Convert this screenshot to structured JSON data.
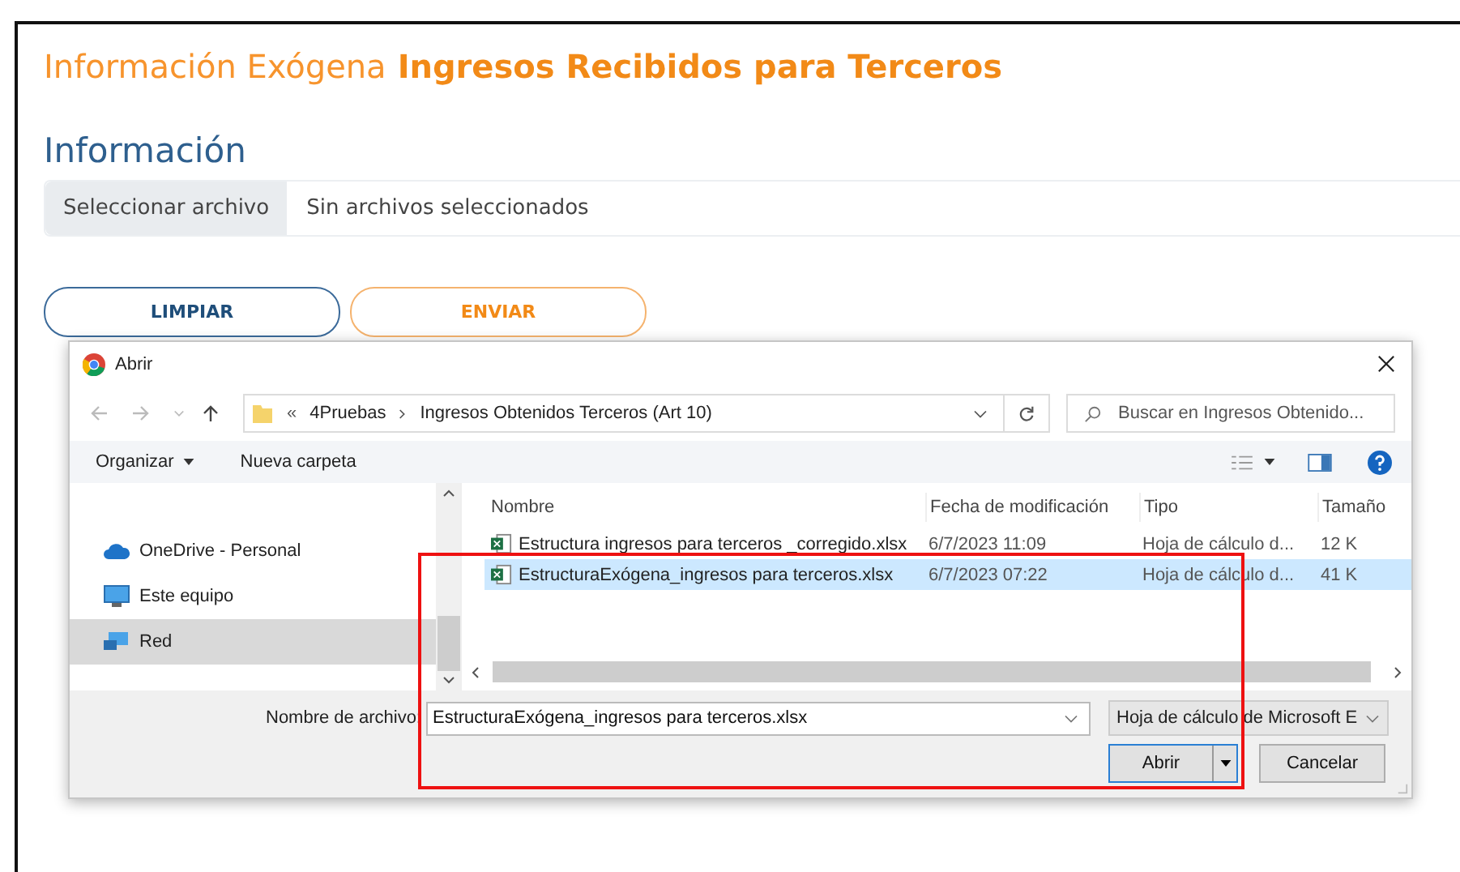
{
  "page": {
    "title_light": "Información Exógena",
    "title_bold": "Ingresos Recibidos para Terceros",
    "section_title": "Información",
    "file_input": {
      "button": "Seleccionar archivo",
      "value": "Sin archivos seleccionados"
    },
    "buttons": [
      {
        "label": "LIMPIAR",
        "kind": "secondary"
      },
      {
        "label": "ENVIAR",
        "kind": "primary"
      }
    ]
  },
  "dialog": {
    "title": "Abrir",
    "address": {
      "overflow": "«",
      "segments": [
        "4Pruebas",
        "Ingresos Obtenidos Terceros (Art 10)"
      ]
    },
    "search": {
      "placeholder": "Buscar en Ingresos Obtenido..."
    },
    "toolbar": {
      "organize": "Organizar",
      "new_folder": "Nueva carpeta"
    },
    "nav_items": [
      {
        "label": "OneDrive - Personal",
        "kind": "cloud",
        "selected": false
      },
      {
        "label": "Este equipo",
        "kind": "computer",
        "selected": false
      },
      {
        "label": "Red",
        "kind": "network",
        "selected": true
      }
    ],
    "columns": [
      "Nombre",
      "Fecha de modificación",
      "Tipo",
      "Tamaño"
    ],
    "files": [
      {
        "name": "Estructura ingresos para terceros _corregido.xlsx",
        "date": "6/7/2023 11:09",
        "type": "Hoja de cálculo d...",
        "size": "12 K",
        "selected": false
      },
      {
        "name": "EstructuraExógena_ingresos para terceros.xlsx",
        "date": "6/7/2023 07:22",
        "type": "Hoja de cálculo d...",
        "size": "41 K",
        "selected": true
      }
    ],
    "filename_label": "Nombre de archivo:",
    "filename": "EstructuraExógena_ingresos para terceros.xlsx",
    "filetype": "Hoja de cálculo de Microsoft E",
    "buttons": [
      {
        "label": "Abrir",
        "kind": "default"
      },
      {
        "label": "Cancelar",
        "kind": "normal"
      }
    ]
  }
}
